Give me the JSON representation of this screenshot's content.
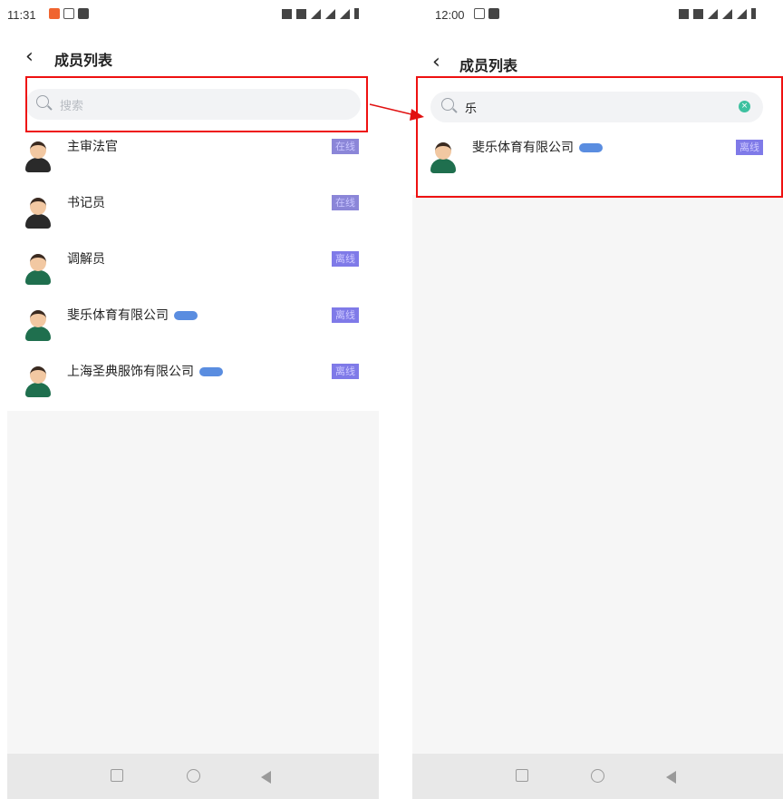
{
  "left": {
    "status_time": "11:31",
    "title": "成员列表",
    "search_placeholder": "搜索",
    "members": [
      {
        "name": "主审法官",
        "status": "在线",
        "badge": false,
        "role": "judge"
      },
      {
        "name": "书记员",
        "status": "在线",
        "badge": false,
        "role": "judge"
      },
      {
        "name": "调解员",
        "status": "离线",
        "badge": false,
        "role": "staff"
      },
      {
        "name": "斐乐体育有限公司",
        "status": "离线",
        "badge": true,
        "role": "staff"
      },
      {
        "name": "上海圣典服饰有限公司",
        "status": "离线",
        "badge": true,
        "role": "staff"
      }
    ]
  },
  "right": {
    "status_time": "12:00",
    "title": "成员列表",
    "search_value": "乐",
    "members": [
      {
        "name": "斐乐体育有限公司",
        "status": "离线",
        "badge": true,
        "role": "staff"
      }
    ]
  },
  "colors": {
    "highlight": "#e11111",
    "status_bg": "#7f7ae8",
    "badge": "#5a8de0"
  }
}
